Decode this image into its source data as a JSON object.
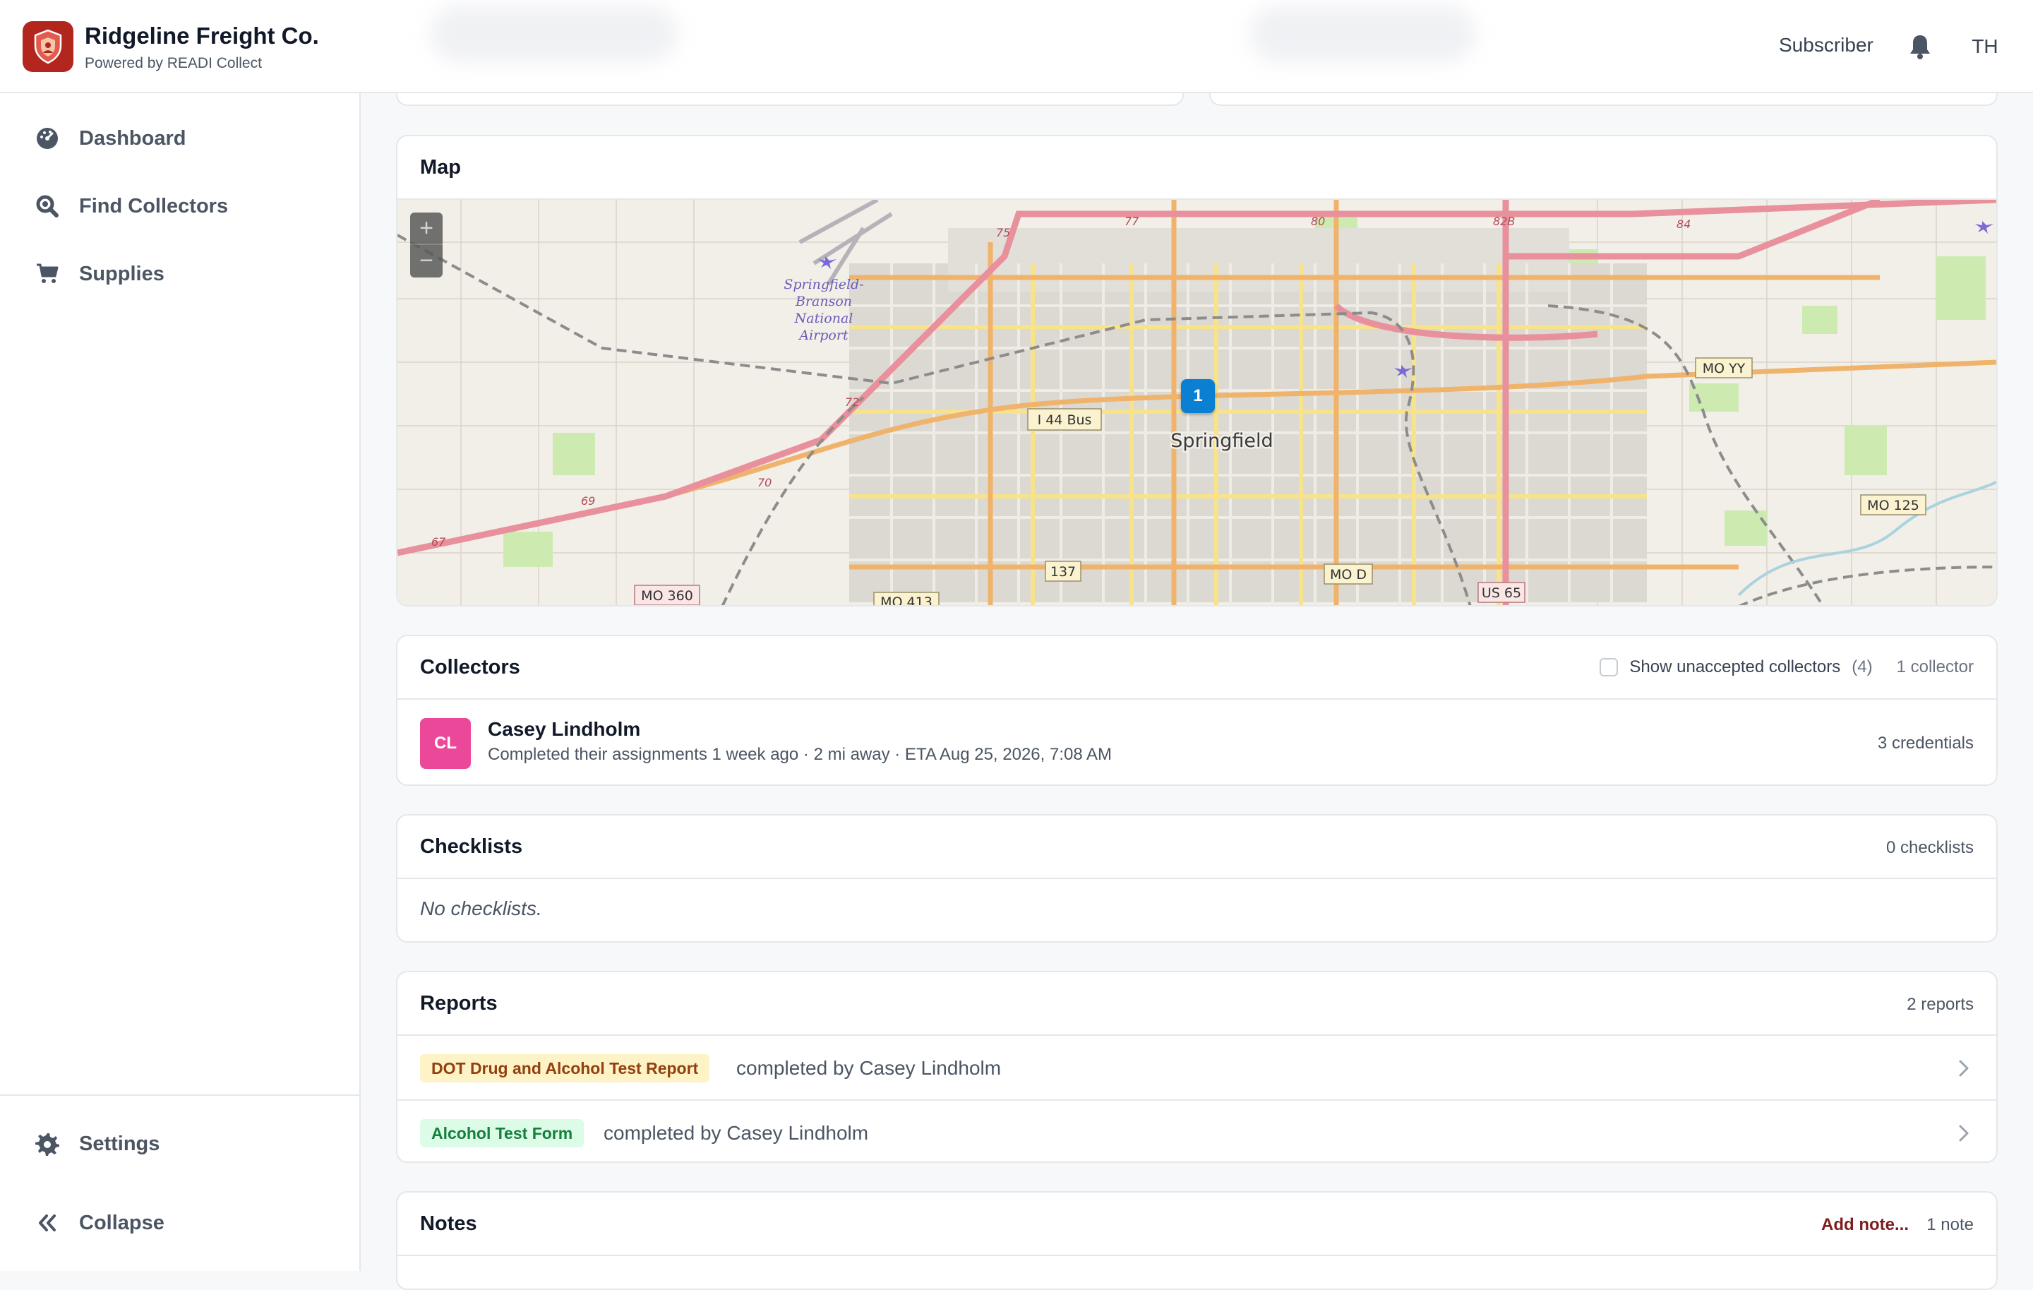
{
  "header": {
    "brand_title": "Ridgeline Freight Co.",
    "brand_sub": "Powered by READI Collect",
    "role": "Subscriber",
    "user_initials": "TH"
  },
  "sidebar": {
    "items": [
      {
        "label": "Dashboard",
        "icon": "dashboard-icon"
      },
      {
        "label": "Find Collectors",
        "icon": "search-icon"
      },
      {
        "label": "Supplies",
        "icon": "cart-icon"
      }
    ],
    "bottom": [
      {
        "label": "Settings",
        "icon": "gear-icon"
      },
      {
        "label": "Collapse",
        "icon": "double-chevron-left-icon"
      }
    ]
  },
  "map": {
    "title": "Map",
    "city_label": "Springfield",
    "marker_count": "1",
    "airport_label": [
      "Springfield-",
      "Branson",
      "National",
      "Airport"
    ],
    "road_labels": [
      "I 44 Bus",
      "MO YY",
      "MO 125",
      "137",
      "MO D",
      "US 65",
      "MO 360",
      "MO 413",
      "75",
      "77",
      "80",
      "82B",
      "84",
      "72",
      "70",
      "69",
      "67"
    ],
    "zoom_in": "+",
    "zoom_out": "−"
  },
  "collectors": {
    "title": "Collectors",
    "show_unaccepted": "Show unaccepted collectors",
    "unaccepted_count": "(4)",
    "count": "1 collector",
    "items": [
      {
        "initials": "CL",
        "name": "Casey Lindholm",
        "detail": "Completed their assignments 1 week ago · 2 mi away · ETA Aug 25, 2026, 7:08 AM",
        "credentials": "3 credentials"
      }
    ]
  },
  "checklists": {
    "title": "Checklists",
    "count": "0 checklists",
    "empty": "No checklists."
  },
  "reports": {
    "title": "Reports",
    "count": "2 reports",
    "items": [
      {
        "badge": "DOT Drug and Alcohol Test Report",
        "text": "completed by Casey Lindholm"
      },
      {
        "badge": "Alcohol Test Form",
        "text": "completed by Casey Lindholm"
      }
    ]
  },
  "notes": {
    "title": "Notes",
    "add": "Add note...",
    "count": "1 note"
  },
  "colors": {
    "brand": "#b3261e",
    "avatar": "#ec4899",
    "marker": "#0b7fd1"
  }
}
